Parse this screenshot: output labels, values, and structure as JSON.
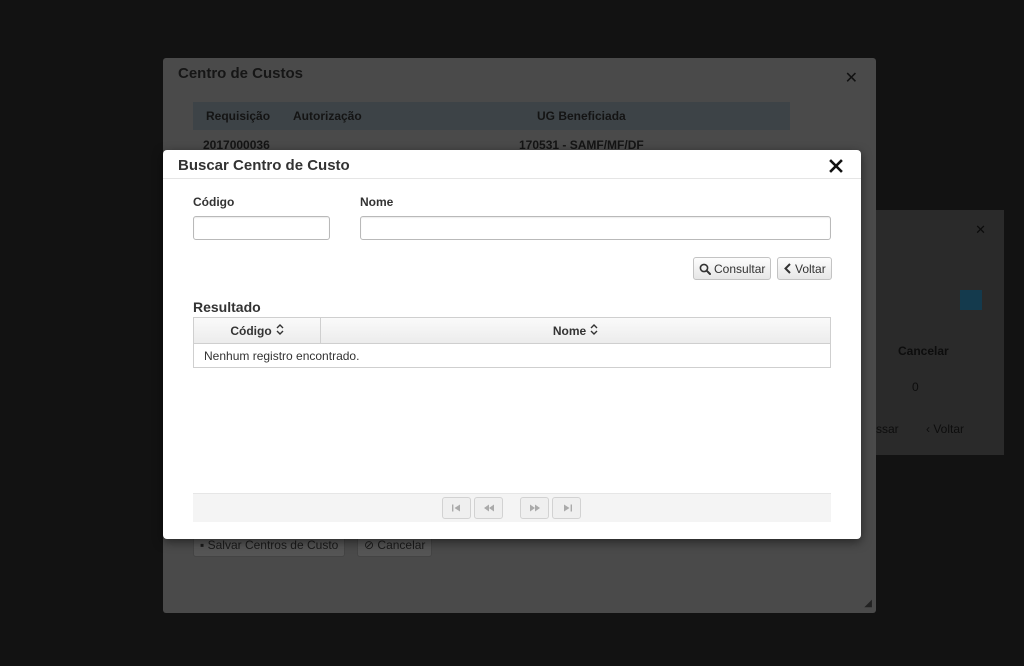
{
  "background_dialog": {
    "title": "Centro de Custos",
    "table_headers": [
      "Requisição",
      "Autorização",
      "UG Beneficiada"
    ],
    "row": {
      "requisicao": "2017000036",
      "ug": "170531 - SAMF/MF/DF"
    },
    "save_label": "Salvar Centros de Custo",
    "cancel_label": "Cancelar"
  },
  "right_fragment": {
    "cancel_header": "Cancelar",
    "value": "0",
    "back_label": "Voltar",
    "partial_label": "ssar"
  },
  "modal": {
    "title": "Buscar Centro de Custo",
    "codigo_label": "Código",
    "codigo_value": "",
    "nome_label": "Nome",
    "nome_value": "",
    "consultar_label": "Consultar",
    "voltar_label": "Voltar",
    "result_title": "Resultado",
    "columns": [
      "Código",
      "Nome"
    ],
    "empty_message": "Nenhum registro encontrado."
  }
}
